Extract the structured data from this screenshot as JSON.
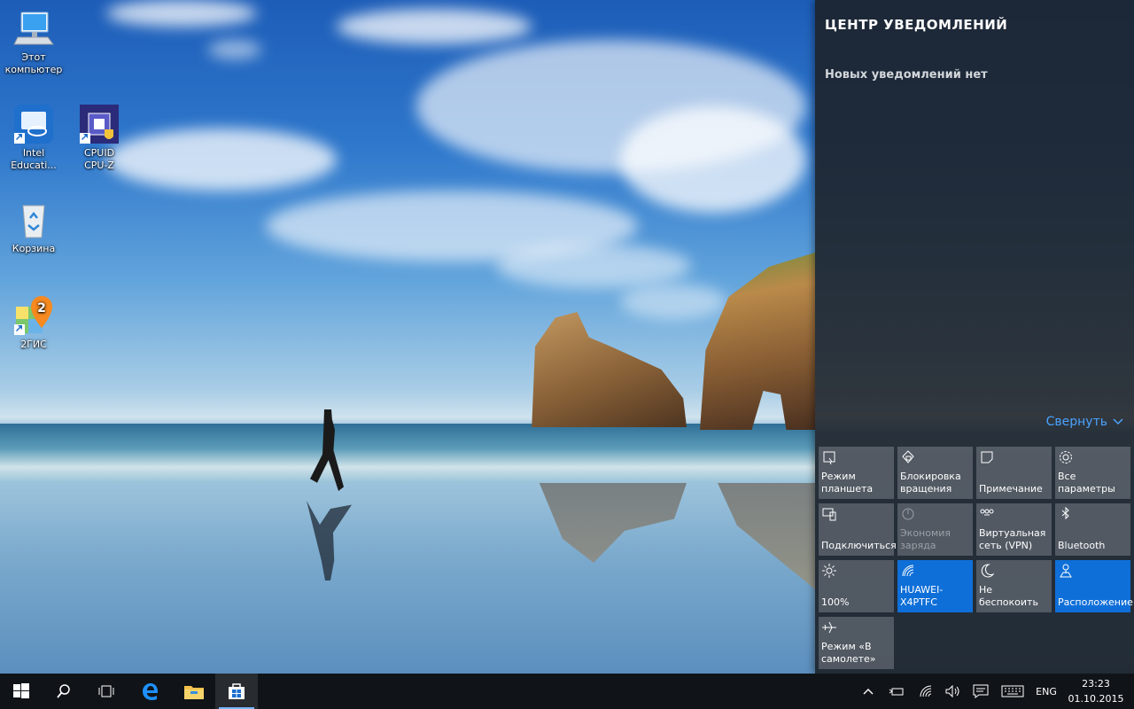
{
  "desktop": {
    "icons": [
      {
        "label": "Этот\nкомпьютер",
        "icon": "computer-icon"
      },
      {
        "label": "Intel\nEducati...",
        "icon": "intel-education-icon"
      },
      {
        "label": "CPUID\nCPU-Z",
        "icon": "cpu-z-icon"
      },
      {
        "label": "Корзина",
        "icon": "recycle-bin-icon"
      },
      {
        "label": "2ГИС",
        "icon": "2gis-icon"
      }
    ]
  },
  "action_center": {
    "title": "ЦЕНТР УВЕДОМЛЕНИЙ",
    "empty_text": "Новых уведомлений нет",
    "collapse_label": "Свернуть",
    "tiles": [
      {
        "label": "Режим\nпланшета",
        "icon": "tablet-mode-icon",
        "state": "off"
      },
      {
        "label": "Блокировка\nвращения",
        "icon": "rotation-lock-icon",
        "state": "off"
      },
      {
        "label": "Примечание",
        "icon": "note-icon",
        "state": "off"
      },
      {
        "label": "Все\nпараметры",
        "icon": "settings-icon",
        "state": "off"
      },
      {
        "label": "Подключиться",
        "icon": "connect-icon",
        "state": "off"
      },
      {
        "label": "Экономия\nзаряда",
        "icon": "battery-saver-icon",
        "state": "disabled"
      },
      {
        "label": "Виртуальная\nсеть (VPN)",
        "icon": "vpn-icon",
        "state": "off"
      },
      {
        "label": "Bluetooth",
        "icon": "bluetooth-icon",
        "state": "off"
      },
      {
        "label": "100%",
        "icon": "brightness-icon",
        "state": "off"
      },
      {
        "label": "HUAWEI-\nX4PTFC",
        "icon": "wifi-icon",
        "state": "on"
      },
      {
        "label": "Не\nбеспокоить",
        "icon": "quiet-hours-icon",
        "state": "off"
      },
      {
        "label": "Расположение",
        "icon": "location-icon",
        "state": "on"
      },
      {
        "label": "Режим «В\nсамолете»",
        "icon": "airplane-icon",
        "state": "off"
      }
    ]
  },
  "taskbar": {
    "pinned": [
      "start-icon",
      "search-icon",
      "task-view-icon",
      "edge-icon",
      "file-explorer-icon",
      "store-icon"
    ],
    "active_app": "store-icon",
    "tray": {
      "language": "ENG",
      "time": "23:23",
      "date": "01.10.2015"
    }
  },
  "colors": {
    "accent": "#0f6fd8",
    "link": "#49a3ff",
    "taskbar": "#101418",
    "panel": "#1c2026"
  }
}
